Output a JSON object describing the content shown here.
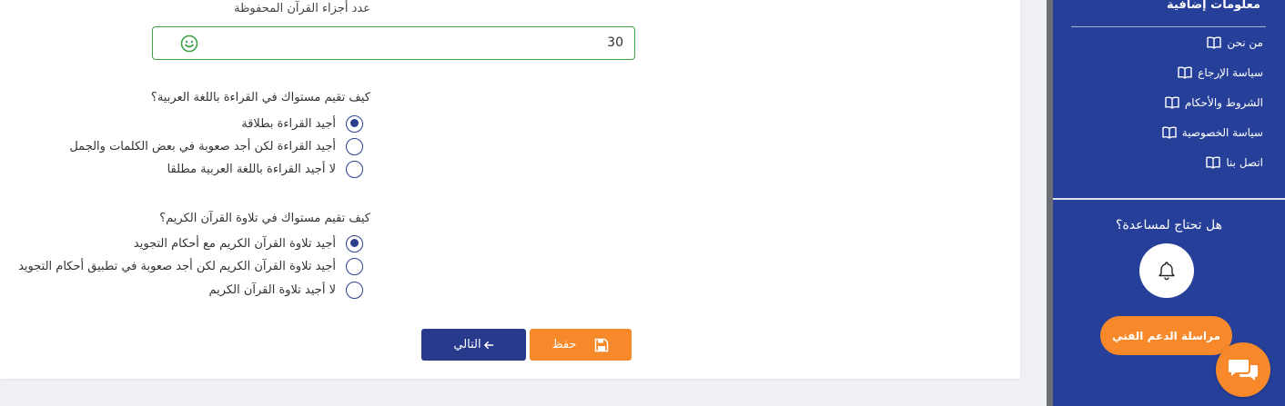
{
  "form": {
    "juz_label": "عدد أجزاء القرآن المحفوظة",
    "juz_value": "30",
    "q_reading": {
      "question": "كيف تقيم مستواك في القراءة باللغة العربية؟",
      "options": [
        {
          "label": "أجيد القراءة بطلاقة",
          "checked": true
        },
        {
          "label": "أجيد القراءة لكن أجد صعوبة في بعض الكلمات والجمل",
          "checked": false
        },
        {
          "label": "لا أجيد القراءة باللغة العربية مطلقا",
          "checked": false
        }
      ]
    },
    "q_recitation": {
      "question": "كيف تقيم مستواك في تلاوة القرآن الكريم؟",
      "options": [
        {
          "label": "أجيد تلاوة القرآن الكريم مع أحكام التجويد",
          "checked": true
        },
        {
          "label": "أجيد تلاوة القرآن الكريم لكن أجد صعوبة في تطبيق أحكام التجويد",
          "checked": false
        },
        {
          "label": "لا أجيد تلاوة القرآن الكريم",
          "checked": false
        }
      ]
    },
    "save_label": "حفظ",
    "next_label": "التالي"
  },
  "sidebar": {
    "title": "معلومات إضافية",
    "links": [
      "من نحن",
      "سياسة الإرجاع",
      "الشروط والأحكام",
      "سياسة الخصوصية",
      "اتصل بنا"
    ],
    "help_title": "هل تحتاج لمساعدة؟",
    "support_button": "مراسلة الدعم الفني"
  },
  "icons": {
    "field_status": "smile-icon",
    "save": "floppy-disk-icon",
    "next": "arrow-left-icon",
    "nav": "book-open-icon",
    "help": "bell-icon",
    "chat": "chat-bubbles-icon"
  },
  "colors": {
    "primary": "#273a8c",
    "sidebar": "#26409a",
    "accent": "#f7892b",
    "valid": "#3fa04a"
  }
}
